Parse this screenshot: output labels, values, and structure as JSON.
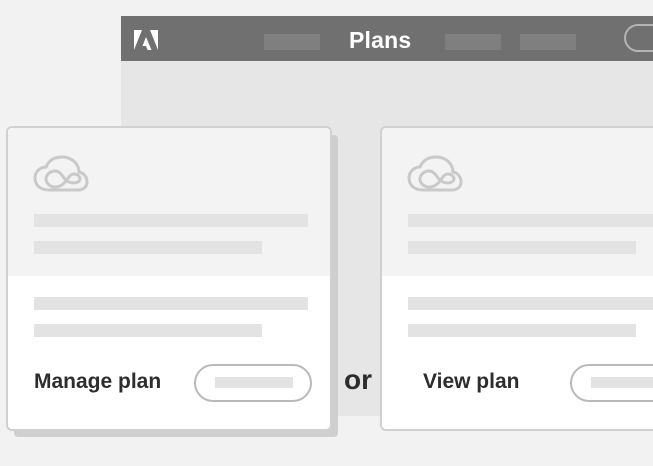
{
  "window": {
    "title": "Plans",
    "logo_icon": "adobe-logo-icon"
  },
  "cards": [
    {
      "icon": "creative-cloud-icon",
      "action_label": "Manage plan"
    },
    {
      "icon": "creative-cloud-icon",
      "action_label": "View plan"
    }
  ],
  "separator": "or",
  "colors": {
    "titlebar": "#707070",
    "window_bg": "#e6e6e6",
    "card_top": "#f3f3f3",
    "placeholder": "#e3e3e3",
    "text": "#2d2d2d"
  }
}
